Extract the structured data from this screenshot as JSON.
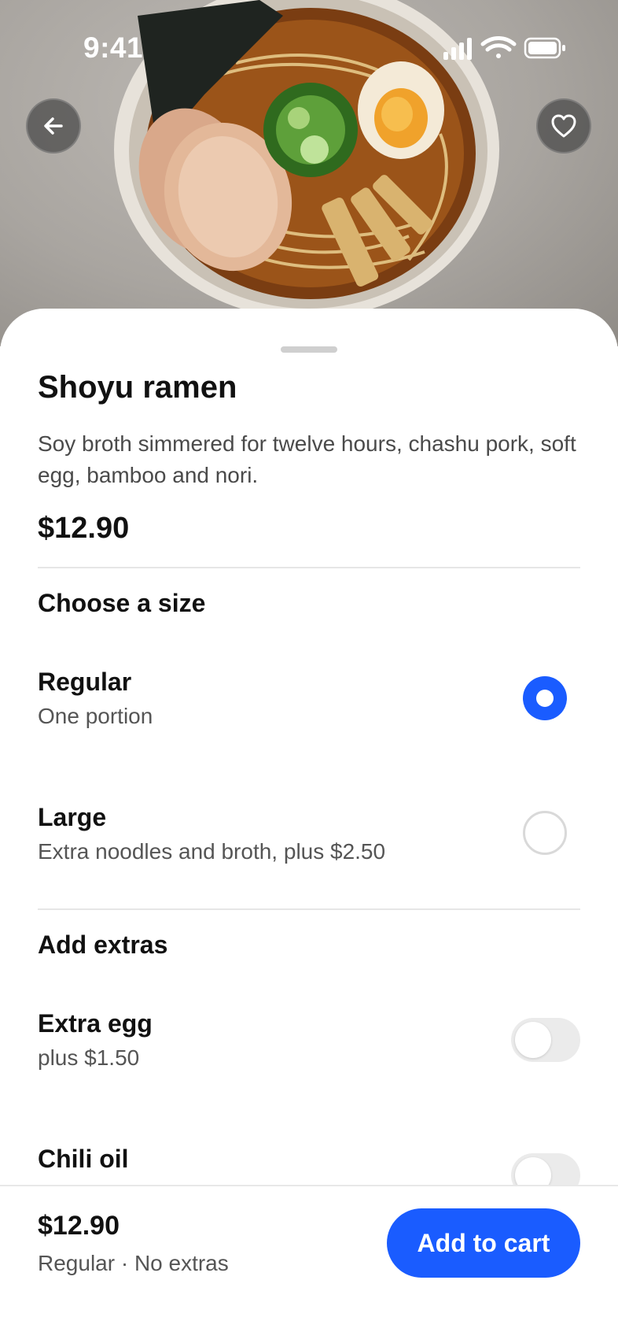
{
  "status_bar": {
    "time": "9:41"
  },
  "header": {
    "back_icon": "arrow-left-icon",
    "favorite_icon": "heart-icon"
  },
  "item": {
    "name": "Shoyu ramen",
    "description": "Soy broth simmered for twelve hours, chashu pork, soft egg, bamboo and nori.",
    "price": "$12.90"
  },
  "size_section": {
    "title": "Choose a size",
    "options": [
      {
        "label": "Regular",
        "detail": "One portion",
        "selected": true
      },
      {
        "label": "Large",
        "detail": "Extra noodles and broth, plus $2.50",
        "selected": false
      }
    ]
  },
  "extras_section": {
    "title": "Add extras",
    "options": [
      {
        "label": "Extra egg",
        "detail": "plus $1.50",
        "enabled": false
      },
      {
        "label": "Chili oil",
        "enabled": false
      }
    ]
  },
  "footer": {
    "total": "$12.90",
    "summary": "Regular · No extras",
    "button_label": "Add to cart"
  },
  "colors": {
    "accent": "#1a5cff"
  }
}
